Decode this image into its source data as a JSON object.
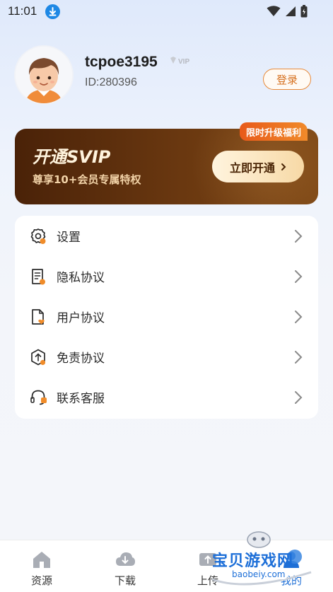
{
  "status_bar": {
    "time": "11:01",
    "icons": [
      "download-icon",
      "wifi-icon",
      "signal-icon",
      "battery-icon"
    ]
  },
  "profile": {
    "username": "tcpoe3195",
    "vip_badge": "VIP",
    "user_id": "ID:280396",
    "login_label": "登录"
  },
  "svip_banner": {
    "promo_tag": "限时升级福利",
    "title": "开通SVIP",
    "subtitle": "尊享10+会员专属特权",
    "button_label": "立即开通",
    "colors": {
      "banner_dark": "#4a2208",
      "banner_light": "#7c4614",
      "promo": "#e85a1a"
    }
  },
  "menu": {
    "items": [
      {
        "label": "设置",
        "icon": "gear-icon"
      },
      {
        "label": "隐私协议",
        "icon": "document-icon"
      },
      {
        "label": "用户协议",
        "icon": "file-heart-icon"
      },
      {
        "label": "免责协议",
        "icon": "upload-shield-icon"
      },
      {
        "label": "联系客服",
        "icon": "headset-icon"
      }
    ]
  },
  "bottom_nav": {
    "items": [
      {
        "label": "资源",
        "icon": "home-icon"
      },
      {
        "label": "下载",
        "icon": "cloud-download-icon"
      },
      {
        "label": "上传",
        "icon": "upload-icon"
      },
      {
        "label": "我的",
        "icon": "user-icon",
        "active": true
      }
    ]
  },
  "watermark": {
    "text": "宝贝游戏网",
    "url": "baobeiy.com"
  },
  "theme": {
    "accent": "#e8892e",
    "text": "#2a2a2a",
    "active_nav": "#1e6fd6"
  }
}
